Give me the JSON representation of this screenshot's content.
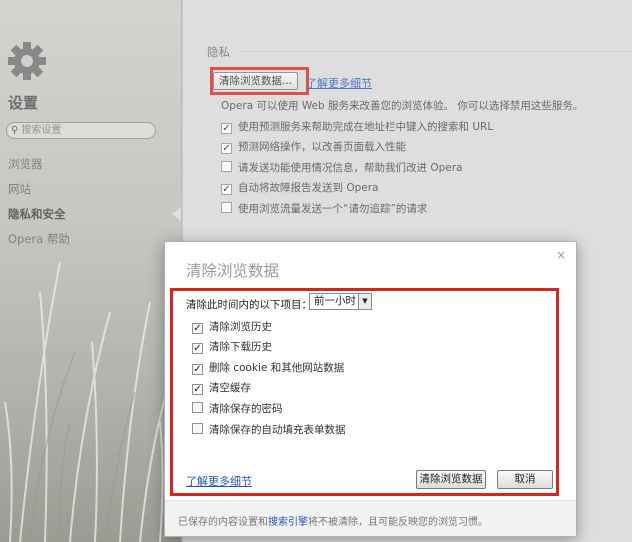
{
  "sidebar": {
    "title": "设置",
    "search_placeholder": "搜索设置",
    "items": [
      {
        "label": "浏览器"
      },
      {
        "label": "网站"
      },
      {
        "label": "隐私和安全"
      },
      {
        "label": "Opera 帮助"
      }
    ]
  },
  "privacy": {
    "section_title": "隐私",
    "clear_button": "清除浏览数据...",
    "learn_more": "了解更多细节",
    "description": "Opera 可以使用 Web 服务来改善您的浏览体验。 你可以选择禁用这些服务。",
    "options": [
      {
        "label": "使用预测服务来帮助完成在地址栏中键入的搜索和 URL",
        "checked": true
      },
      {
        "label": "预测网络操作，以改善页面载入性能",
        "checked": true
      },
      {
        "label": "请发送功能使用情况信息，帮助我们改进 Opera",
        "checked": false
      },
      {
        "label": "自动将故障报告发送到 Opera",
        "checked": true
      },
      {
        "label": "使用浏览流量发送一个“请勿追踪”的请求",
        "checked": false
      }
    ]
  },
  "dialog": {
    "title": "清除浏览数据",
    "close": "×",
    "range_label": "清除此时间内的以下项目：",
    "range_value": "前一小时",
    "options": [
      {
        "label": "清除浏览历史",
        "checked": true
      },
      {
        "label": "清除下载历史",
        "checked": true
      },
      {
        "label": "删除 cookie 和其他网站数据",
        "checked": true
      },
      {
        "label": "清空缓存",
        "checked": true
      },
      {
        "label": "清除保存的密码",
        "checked": false
      },
      {
        "label": "清除保存的自动填充表单数据",
        "checked": false
      }
    ],
    "learn_more": "了解更多细节",
    "confirm_button": "清除浏览数据",
    "cancel_button": "取消",
    "footer_prefix": "已保存的内容设置和",
    "footer_link": "搜索引擎",
    "footer_suffix": "将不被清除，且可能反映您的浏览习惯。"
  },
  "check_mark": "✓",
  "colors": {
    "highlight": "#d9231d",
    "link": "#2255bb"
  }
}
